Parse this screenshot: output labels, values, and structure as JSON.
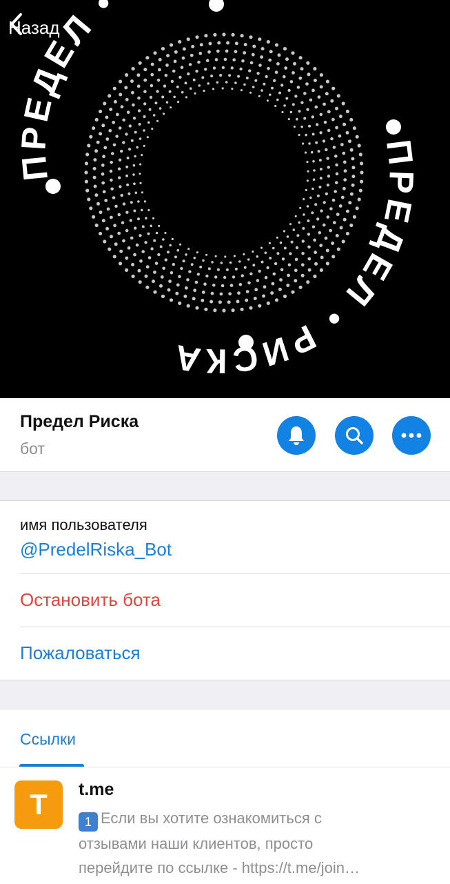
{
  "nav": {
    "back_label": "Назад"
  },
  "hero": {
    "logo_text_top": "ПРЕДЕЛ • РИСКА",
    "logo_text_bottom": "ПРЕДЕЛ • РИСКА",
    "background": "#000000",
    "dots_color": "#c8c8c8"
  },
  "profile": {
    "name": "Предел Риска",
    "subtitle": "бот",
    "accent": "#1282e4"
  },
  "info": {
    "username_label": "имя пользователя",
    "username_value": "@PredelRiska_Bot",
    "stop_bot_label": "Остановить бота",
    "stop_color": "#e0443c",
    "report_label": "Пожаловаться",
    "link_color": "#1a7fd6"
  },
  "tabs": {
    "links_label": "Ссылки"
  },
  "links": [
    {
      "thumb_letter": "T",
      "title": "t.me",
      "emoji_label": "1",
      "line1": "Если вы хотите ознакомиться с",
      "line2": "отзывами наши клиентов, просто",
      "line3": "перейдите по ссылке - https://t.me/join…"
    }
  ]
}
